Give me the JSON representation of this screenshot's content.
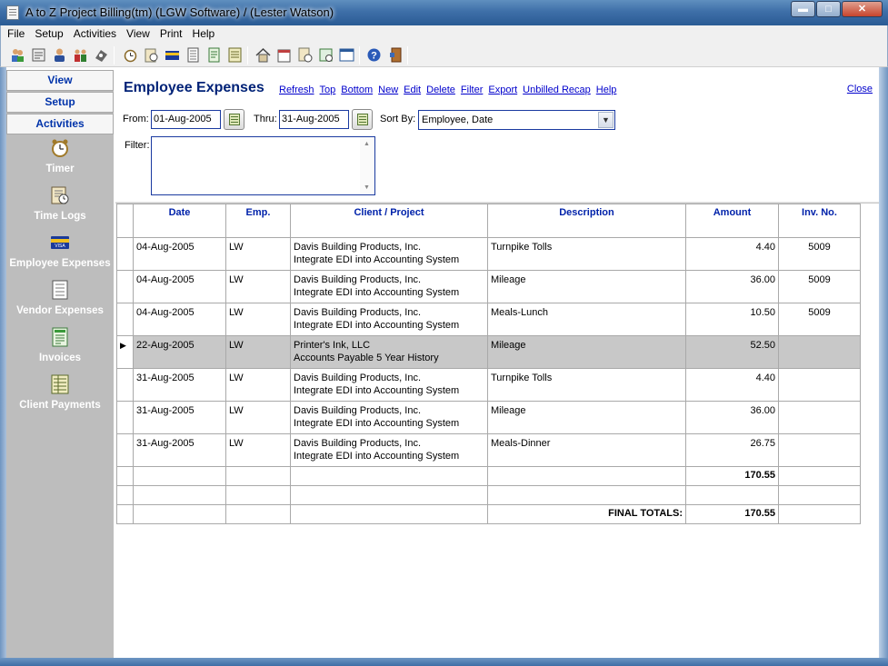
{
  "window": {
    "title": "A to Z Project Billing(tm)   (LGW Software) / (Lester Watson)",
    "min": "▬",
    "max": "□",
    "close": "✕"
  },
  "menu": [
    "File",
    "Setup",
    "Activities",
    "View",
    "Print",
    "Help"
  ],
  "toolbar_icons": [
    "clients-icon",
    "projects-icon",
    "employee-icon",
    "employees-icon",
    "vendor-icon",
    "timer-icon",
    "time-logs-icon",
    "employee-expenses-icon",
    "vendor-expenses-icon",
    "invoices-icon",
    "client-payments-icon",
    "home-icon",
    "calendar-icon",
    "reports-icon",
    "schedule-icon",
    "window-icon",
    "help-icon",
    "exit-icon"
  ],
  "sidebar": {
    "nav": [
      "View",
      "Setup",
      "Activities"
    ],
    "items": [
      {
        "label": "Timer",
        "icon": "alarm-clock-icon"
      },
      {
        "label": "Time Logs",
        "icon": "clipboard-clock-icon"
      },
      {
        "label": "Employee Expenses",
        "icon": "credit-card-icon"
      },
      {
        "label": "Vendor Expenses",
        "icon": "calculator-sheet-icon"
      },
      {
        "label": "Invoices",
        "icon": "invoice-icon"
      },
      {
        "label": "Client Payments",
        "icon": "ledger-icon"
      }
    ]
  },
  "page": {
    "title": "Employee Expenses",
    "links": [
      "Refresh",
      "Top",
      "Bottom",
      "New",
      "Edit",
      "Delete",
      "Filter",
      "Export",
      "Unbilled Recap",
      "Help"
    ],
    "close": "Close"
  },
  "filters": {
    "from_label": "From:",
    "from_value": "01-Aug-2005",
    "thru_label": "Thru:",
    "thru_value": "31-Aug-2005",
    "sort_label": "Sort By:",
    "sort_value": "Employee, Date",
    "filter_label": "Filter:",
    "filter_value": ""
  },
  "grid": {
    "columns": [
      "Date",
      "Emp.",
      "Client / Project",
      "Description",
      "Amount",
      "Inv. No."
    ],
    "rows": [
      {
        "date": "04-Aug-2005",
        "emp": "LW",
        "client": "Davis Building Products, Inc.",
        "project": "Integrate EDI into Accounting System",
        "desc": "Turnpike Tolls",
        "amount": "4.40",
        "inv": "5009",
        "selected": false
      },
      {
        "date": "04-Aug-2005",
        "emp": "LW",
        "client": "Davis Building Products, Inc.",
        "project": "Integrate EDI into Accounting System",
        "desc": "Mileage",
        "amount": "36.00",
        "inv": "5009",
        "selected": false
      },
      {
        "date": "04-Aug-2005",
        "emp": "LW",
        "client": "Davis Building Products, Inc.",
        "project": "Integrate EDI into Accounting System",
        "desc": "Meals-Lunch",
        "amount": "10.50",
        "inv": "5009",
        "selected": false
      },
      {
        "date": "22-Aug-2005",
        "emp": "LW",
        "client": "Printer's Ink, LLC",
        "project": "Accounts Payable 5 Year History",
        "desc": "Mileage",
        "amount": "52.50",
        "inv": "",
        "selected": true
      },
      {
        "date": "31-Aug-2005",
        "emp": "LW",
        "client": "Davis Building Products, Inc.",
        "project": "Integrate EDI into Accounting System",
        "desc": "Turnpike Tolls",
        "amount": "4.40",
        "inv": "",
        "selected": false
      },
      {
        "date": "31-Aug-2005",
        "emp": "LW",
        "client": "Davis Building Products, Inc.",
        "project": "Integrate EDI into Accounting System",
        "desc": "Mileage",
        "amount": "36.00",
        "inv": "",
        "selected": false
      },
      {
        "date": "31-Aug-2005",
        "emp": "LW",
        "client": "Davis Building Products, Inc.",
        "project": "Integrate EDI into Accounting System",
        "desc": "Meals-Dinner",
        "amount": "26.75",
        "inv": "",
        "selected": false
      }
    ],
    "subtotal": "170.55",
    "final_label": "FINAL TOTALS:",
    "final_total": "170.55"
  }
}
